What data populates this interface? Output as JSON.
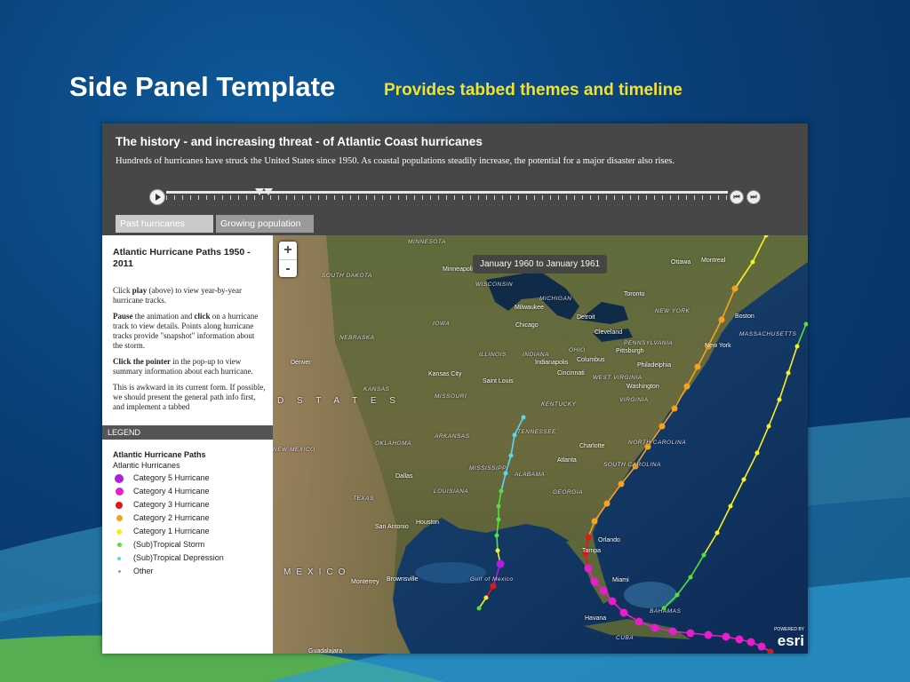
{
  "slide": {
    "title": "Side Panel Template",
    "subtitle": "Provides tabbed themes and timeline"
  },
  "app": {
    "title": "The history - and increasing threat - of Atlantic Coast hurricanes",
    "description": "Hundreds of hurricanes have struck the United States since 1950. As coastal populations steadily increase, the potential for a major disaster also rises.",
    "tabs": [
      {
        "label": "Past hurricanes",
        "active": true
      },
      {
        "label": "Growing population",
        "active": false
      }
    ]
  },
  "side_panel": {
    "title": "Atlantic Hurricane Paths 1950 - 2011",
    "paragraphs": [
      {
        "bold": "",
        "parts": [
          [
            "Click ",
            ""
          ],
          [
            "play",
            "b"
          ],
          [
            " (above) to view year-by-year hurricane tracks.",
            ""
          ]
        ]
      },
      {
        "parts": [
          [
            "Pause",
            "b"
          ],
          [
            " the animation and ",
            ""
          ],
          [
            "click",
            "b"
          ],
          [
            " on a hurricane track to view details. Points along hurricane tracks provide \"snapshot\" information about the storm.",
            ""
          ]
        ]
      },
      {
        "parts": [
          [
            "Click the pointer",
            "b"
          ],
          [
            " in the pop-up to view summary information about each hurricane.",
            ""
          ]
        ]
      },
      {
        "parts": [
          [
            "This is awkward in its current form. If possible, we should present the general path info first, and implement a tabbed",
            ""
          ]
        ]
      }
    ],
    "legend_header": "LEGEND",
    "legend_title": "Atlantic Hurricane Paths",
    "legend_subtitle": "Atlantic Hurricanes",
    "legend_items": [
      {
        "label": "Category 5 Hurricane",
        "color": "#b01ee0",
        "size": 10
      },
      {
        "label": "Category 4 Hurricane",
        "color": "#e81ec8",
        "size": 9
      },
      {
        "label": "Category 3 Hurricane",
        "color": "#e01818",
        "size": 8
      },
      {
        "label": "Category 2 Hurricane",
        "color": "#f5a21e",
        "size": 7
      },
      {
        "label": "Category 1 Hurricane",
        "color": "#f5f01e",
        "size": 6
      },
      {
        "label": "(Sub)Tropical Storm",
        "color": "#55e03a",
        "size": 5
      },
      {
        "label": "(Sub)Tropical Depression",
        "color": "#5ad8ee",
        "size": 4
      },
      {
        "label": "Other",
        "color": "#999999",
        "size": 3
      }
    ]
  },
  "map": {
    "time_label": "January 1960 to January 1961",
    "zoom_in": "+",
    "zoom_out": "-",
    "esri_powered": "POWERED BY",
    "esri_logo": "esri",
    "places": [
      "MINNESOTA",
      "SOUTH DAKOTA",
      "NEBRASKA",
      "IOWA",
      "WISCONSIN",
      "MICHIGAN",
      "ILLINOIS",
      "INDIANA",
      "OHIO",
      "KANSAS",
      "MISSOURI",
      "KENTUCKY",
      "ARKANSAS",
      "TENNESSEE",
      "OKLAHOMA",
      "MISSISSIPPI",
      "ALABAMA",
      "GEORGIA",
      "LOUISIANA",
      "TEXAS",
      "NEW YORK",
      "PENNSYLVANIA",
      "VIRGINIA",
      "WEST VIRGINIA",
      "NORTH CAROLINA",
      "SOUTH CAROLINA",
      "MASSACHUSETTS",
      "NEW MEXICO",
      "MEXICO",
      "BAHAMAS",
      "CUBA",
      "D  S T A T E S",
      "Minneapolis",
      "Chicago",
      "Milwaukee",
      "Detroit",
      "Cleveland",
      "Toronto",
      "Ottawa",
      "Montreal",
      "Boston",
      "New York",
      "Pittsburgh",
      "Philadelphia",
      "Washington",
      "Indianapolis",
      "Columbus",
      "Cincinnati",
      "Saint Louis",
      "Kansas City",
      "Denver",
      "Dallas",
      "Houston",
      "San Antonio",
      "Atlanta",
      "Charlotte",
      "Orlando",
      "Tampa",
      "Miami",
      "Havana",
      "Monterrey",
      "Brownsville",
      "Gulf of Mexico",
      "Guadalajara"
    ]
  }
}
